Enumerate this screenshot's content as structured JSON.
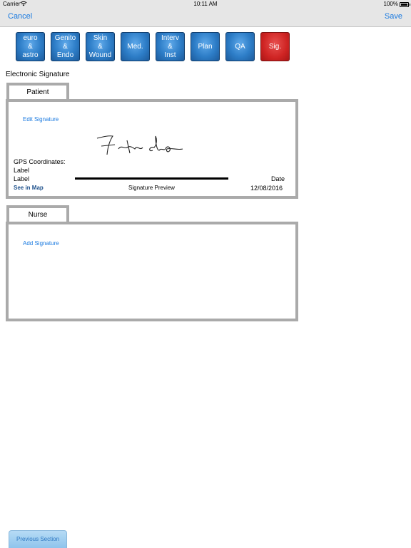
{
  "status_bar": {
    "carrier": "Carrier",
    "time": "10:11 AM",
    "battery": "100%",
    "battery_level": 1.0
  },
  "nav": {
    "cancel_label": "Cancel",
    "save_label": "Save"
  },
  "tabs": [
    {
      "label": "euro\n&\nastro"
    },
    {
      "label": "Genito\n&\nEndo"
    },
    {
      "label": "Skin\n&\nWound"
    },
    {
      "label": "Med."
    },
    {
      "label": "Interv\n&\nInst"
    },
    {
      "label": "Plan"
    },
    {
      "label": "QA"
    },
    {
      "label": "Sig.",
      "active": true
    }
  ],
  "section_title": "Electronic Signature",
  "patient": {
    "tab_label": "Patient",
    "edit_signature": "Edit Signature",
    "gps_label": "GPS Coordinates:",
    "label_1": "Label",
    "label_2": "Label",
    "see_in_map": "See in Map",
    "signature_preview": "Signature Preview",
    "date_label": "Date",
    "date_value": "12/08/2016"
  },
  "nurse": {
    "tab_label": "Nurse",
    "add_signature": "Add Signature"
  },
  "footer": {
    "previous_section": "Previous Section"
  },
  "colors": {
    "link": "#1a7ae0",
    "tab_blue": "#2d7dc7",
    "tab_active_red": "#cf2423",
    "frame_gray": "#aaaaaa"
  }
}
